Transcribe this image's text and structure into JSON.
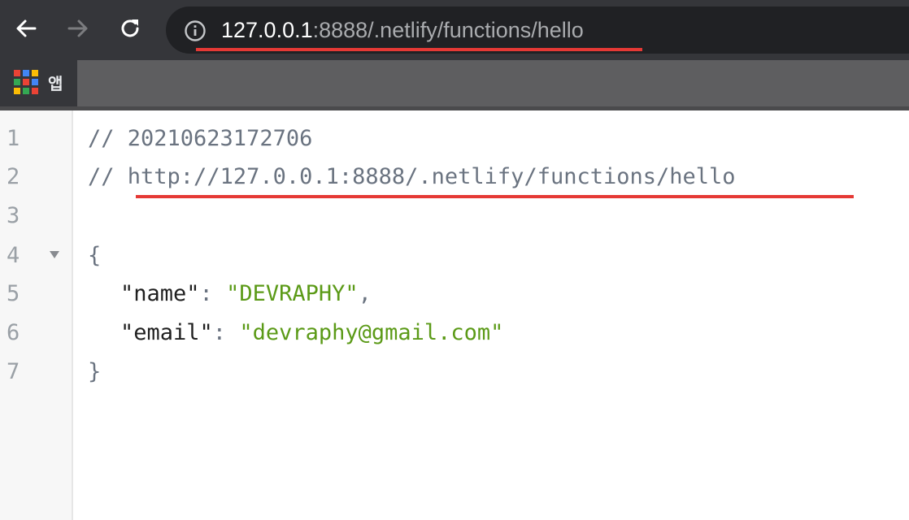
{
  "browser": {
    "url_host": "127.0.0.1",
    "url_rest": ":8888/.netlify/functions/hello",
    "bookmarks_bar": {
      "apps_label": "앱",
      "apps_colors": [
        "#ea4335",
        "#4285f4",
        "#fbbc05",
        "#34a853",
        "#ea4335",
        "#4285f4",
        "#fbbc05",
        "#34a853",
        "#ea4335"
      ]
    }
  },
  "editor": {
    "line_numbers": [
      "1",
      "2",
      "3",
      "4",
      "5",
      "6",
      "7"
    ],
    "line1_comment": "// 20210623172706",
    "line2_prefix": "// ",
    "line2_link": "http://127.0.0.1:8888/.netlify/functions/hello",
    "open_brace": "{",
    "close_brace": "}",
    "name_key": "\"name\"",
    "name_value": "\"DEVRAPHY\"",
    "email_key": "\"email\"",
    "email_value": "\"devraphy@gmail.com\"",
    "colon": ": ",
    "comma": ","
  },
  "colors": {
    "highlight_underline": "#e53935",
    "string_value": "#5b9a17",
    "comment": "#6a7380"
  }
}
